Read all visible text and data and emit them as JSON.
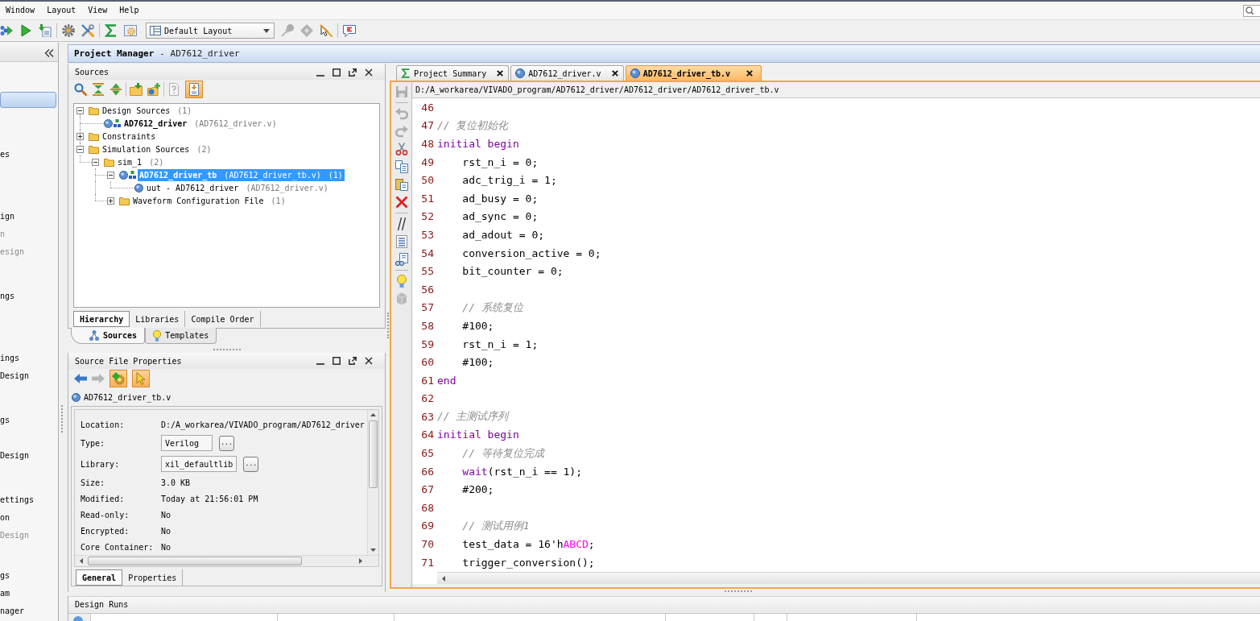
{
  "menu": [
    {
      "label": "Window"
    },
    {
      "label": "Layout"
    },
    {
      "label": "View"
    },
    {
      "label": "Help"
    }
  ],
  "toolbar": {
    "buttons": [
      {
        "disabled": false
      },
      {
        "disabled": false
      },
      {
        "disabled": false
      },
      {
        "disabled": false
      },
      {
        "disabled": false
      },
      {
        "disabled": false
      },
      {
        "disabled": false
      },
      {
        "disabled": true
      },
      {
        "disabled": true
      },
      {
        "disabled": false
      },
      {
        "disabled": false
      }
    ],
    "layout": {
      "value": "Default Layout"
    }
  },
  "navigator": {
    "groups": [
      {
        "items": [
          {
            "selected": true
          }
        ]
      },
      {
        "items": [
          {
            "label": "es",
            "selected": false,
            "disabled": false
          }
        ]
      },
      {
        "items": [
          {
            "label": "ign",
            "selected": false,
            "disabled": false
          },
          {
            "label": "n",
            "selected": false,
            "disabled": true
          },
          {
            "label": "esign",
            "selected": false,
            "disabled": true
          }
        ]
      },
      {
        "items": [
          {
            "label": "ngs",
            "selected": false,
            "disabled": false
          }
        ]
      },
      {
        "items": [
          {
            "label": "ings",
            "selected": false,
            "disabled": false
          },
          {
            "label": "Design",
            "selected": false,
            "disabled": false
          }
        ]
      },
      {
        "items": [
          {
            "label": "gs",
            "selected": false,
            "disabled": false
          }
        ]
      },
      {
        "items": [
          {
            "label": "Design",
            "selected": false,
            "disabled": false
          }
        ]
      },
      {
        "items": [
          {
            "label": "ettings",
            "selected": false,
            "disabled": false
          },
          {
            "label": "on",
            "selected": false,
            "disabled": false
          },
          {
            "label": "Design",
            "selected": false,
            "disabled": true
          }
        ]
      },
      {
        "items": [
          {
            "label": "gs",
            "selected": false,
            "disabled": false
          },
          {
            "label": "am",
            "selected": false,
            "disabled": false
          },
          {
            "label": "nager",
            "selected": false,
            "disabled": false
          }
        ]
      }
    ]
  },
  "project_manager": {
    "title": "Project Manager",
    "subtitle": "- AD7612_driver"
  },
  "sources": {
    "title": "Sources",
    "toolbar": [
      {
        "disabled": false,
        "on": false
      },
      {
        "disabled": false,
        "on": false
      },
      {
        "disabled": false,
        "on": false
      },
      {
        "disabled": false,
        "on": false
      },
      {
        "disabled": false,
        "on": false
      },
      {
        "disabled": true,
        "on": false
      },
      {
        "disabled": false,
        "on": true
      }
    ],
    "tree": [
      {
        "kind": "folder",
        "label": "Design Sources",
        "count": "(1)",
        "expanded": true,
        "selected": false,
        "children": [
          {
            "kind": "module",
            "label": "AD7612_driver",
            "file": "(AD7612_driver.v)",
            "top": true,
            "selected": false
          }
        ]
      },
      {
        "kind": "folder",
        "label": "Constraints",
        "expanded": false,
        "selected": false
      },
      {
        "kind": "folder",
        "label": "Simulation Sources",
        "count": "(2)",
        "expanded": true,
        "selected": false,
        "children": [
          {
            "kind": "folder",
            "label": "sim_1",
            "count": "(2)",
            "expanded": true,
            "selected": false,
            "children": [
              {
                "kind": "module",
                "label": "AD7612_driver_tb",
                "file": "(AD7612_driver_tb.v)",
                "count": "(1)",
                "top": true,
                "expanded": true,
                "selected": true,
                "children": [
                  {
                    "kind": "instance",
                    "label": "uut - AD7612_driver",
                    "file": "(AD7612_driver.v)",
                    "selected": false
                  }
                ]
              },
              {
                "kind": "folder",
                "label": "Waveform Configuration File",
                "count": "(1)",
                "expanded": false,
                "selected": false
              }
            ]
          }
        ]
      }
    ],
    "view_tabs": [
      {
        "label": "Hierarchy",
        "selected": true
      },
      {
        "label": "Libraries",
        "selected": false
      },
      {
        "label": "Compile Order",
        "selected": false
      }
    ]
  },
  "panel_tabs": [
    {
      "label": "Sources",
      "selected": true
    },
    {
      "label": "Templates",
      "selected": false
    }
  ],
  "properties": {
    "title": "Source File Properties",
    "toolbar": [
      {
        "disabled": false,
        "on": false
      },
      {
        "disabled": true,
        "on": false
      },
      {
        "disabled": false,
        "on": true
      },
      {
        "disabled": false,
        "on": true
      }
    ],
    "file": "AD7612_driver_tb.v",
    "rows": [
      {
        "kind": "text",
        "label": "Location:",
        "value": "D:/A_workarea/VIVADO_program/AD7612_driver"
      },
      {
        "kind": "field",
        "label": "Type:",
        "value": "Verilog",
        "button": "..."
      },
      {
        "kind": "field",
        "label": "Library:",
        "value": "xil_defaultlib",
        "button": "..."
      },
      {
        "kind": "text",
        "label": "Size:",
        "value": "3.0 KB"
      },
      {
        "kind": "text",
        "label": "Modified:",
        "value": "Today at 21:56:01 PM"
      },
      {
        "kind": "text",
        "label": "Read-only:",
        "value": "No"
      },
      {
        "kind": "text",
        "label": "Encrypted:",
        "value": "No"
      },
      {
        "kind": "text",
        "label": "Core Container:",
        "value": "No"
      }
    ],
    "tabs": [
      {
        "label": "General",
        "selected": true
      },
      {
        "label": "Properties",
        "selected": false
      }
    ]
  },
  "editor": {
    "tabs": [
      {
        "kind": "summary",
        "label": "Project Summary",
        "selected": false
      },
      {
        "kind": "file",
        "label": "AD7612_driver.v",
        "selected": false
      },
      {
        "kind": "file",
        "label": "AD7612_driver_tb.v",
        "selected": true
      }
    ],
    "path": "D:/A_workarea/VIVADO_program/AD7612_driver/AD7612_driver/AD7612_driver_tb.v",
    "toolbar": [
      {
        "disabled": true
      },
      {
        "disabled": true
      },
      {
        "disabled": true
      },
      {
        "disabled": false
      },
      {
        "disabled": false
      },
      {
        "disabled": false
      },
      {
        "disabled": false
      },
      {
        "disabled": false
      },
      {
        "disabled": false
      },
      {
        "disabled": false
      },
      {
        "disabled": false
      },
      {
        "disabled": true
      }
    ],
    "lines": [
      {
        "number": "46"
      },
      {
        "number": "47",
        "tokens": [
          {
            "kind": "comment",
            "text": "// 复位初始化"
          }
        ]
      },
      {
        "number": "48",
        "tokens": [
          {
            "kind": "keyword",
            "text": "initial begin"
          }
        ]
      },
      {
        "number": "49",
        "tokens": [
          {
            "kind": "plain",
            "text": "    rst_n_i = 0;"
          }
        ]
      },
      {
        "number": "50",
        "tokens": [
          {
            "kind": "plain",
            "text": "    adc_trig_i = 1;"
          }
        ]
      },
      {
        "number": "51",
        "tokens": [
          {
            "kind": "plain",
            "text": "    ad_busy = 0;"
          }
        ]
      },
      {
        "number": "52",
        "tokens": [
          {
            "kind": "plain",
            "text": "    ad_sync = 0;"
          }
        ]
      },
      {
        "number": "53",
        "tokens": [
          {
            "kind": "plain",
            "text": "    ad_adout = 0;"
          }
        ]
      },
      {
        "number": "54",
        "tokens": [
          {
            "kind": "plain",
            "text": "    conversion_active = 0;"
          }
        ]
      },
      {
        "number": "55",
        "tokens": [
          {
            "kind": "plain",
            "text": "    bit_counter = 0;"
          }
        ]
      },
      {
        "number": "56"
      },
      {
        "number": "57",
        "tokens": [
          {
            "kind": "comment",
            "text": "    // 系统复位"
          }
        ]
      },
      {
        "number": "58",
        "tokens": [
          {
            "kind": "plain",
            "text": "    #100;"
          }
        ]
      },
      {
        "number": "59",
        "tokens": [
          {
            "kind": "plain",
            "text": "    rst_n_i = 1;"
          }
        ]
      },
      {
        "number": "60",
        "tokens": [
          {
            "kind": "plain",
            "text": "    #100;"
          }
        ]
      },
      {
        "number": "61",
        "tokens": [
          {
            "kind": "keyword",
            "text": "end"
          }
        ]
      },
      {
        "number": "62"
      },
      {
        "number": "63",
        "tokens": [
          {
            "kind": "comment",
            "text": "// 主测试序列"
          }
        ]
      },
      {
        "number": "64",
        "tokens": [
          {
            "kind": "keyword",
            "text": "initial begin"
          }
        ]
      },
      {
        "number": "65",
        "tokens": [
          {
            "kind": "comment",
            "text": "    // 等待复位完成"
          }
        ]
      },
      {
        "number": "66",
        "tokens": [
          {
            "kind": "keyword",
            "text": "    wait"
          },
          {
            "kind": "plain",
            "text": "(rst_n_i == 1);"
          }
        ]
      },
      {
        "number": "67",
        "tokens": [
          {
            "kind": "plain",
            "text": "    #200;"
          }
        ]
      },
      {
        "number": "68"
      },
      {
        "number": "69",
        "tokens": [
          {
            "kind": "comment",
            "text": "    // 测试用例1"
          }
        ]
      },
      {
        "number": "70",
        "tokens": [
          {
            "kind": "plain",
            "text": "    test_data = 16'h"
          },
          {
            "kind": "literal",
            "text": "ABCD"
          },
          {
            "kind": "plain",
            "text": ";"
          }
        ]
      },
      {
        "number": "71",
        "tokens": [
          {
            "kind": "plain",
            "text": "    trigger_conversion();"
          }
        ]
      }
    ]
  },
  "design_runs": {
    "title": "Design Runs"
  }
}
